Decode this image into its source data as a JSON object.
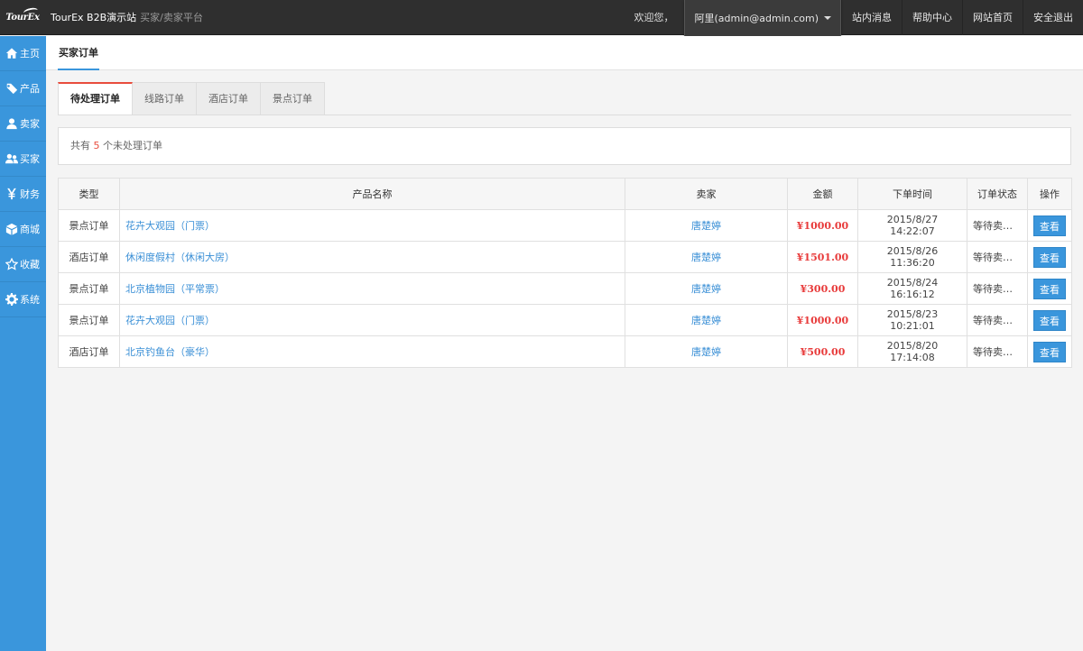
{
  "topbar": {
    "logo_text": "TourEx",
    "site_title": "TourEx B2B演示站",
    "site_subtitle": "买家/卖家平台",
    "welcome": "欢迎您，",
    "user": "阿里(admin@admin.com)",
    "links": [
      "站内消息",
      "帮助中心",
      "网站首页",
      "安全退出"
    ]
  },
  "sidebar": {
    "items": [
      {
        "label": "主页",
        "icon": "home-icon"
      },
      {
        "label": "产品",
        "icon": "tag-icon"
      },
      {
        "label": "卖家",
        "icon": "user-icon"
      },
      {
        "label": "买家",
        "icon": "users-icon"
      },
      {
        "label": "财务",
        "icon": "yen-icon"
      },
      {
        "label": "商城",
        "icon": "box-icon"
      },
      {
        "label": "收藏",
        "icon": "star-icon"
      },
      {
        "label": "系统",
        "icon": "gear-icon"
      }
    ]
  },
  "page": {
    "title": "买家订单",
    "tabs": [
      "待处理订单",
      "线路订单",
      "酒店订单",
      "景点订单"
    ],
    "summary_prefix": "共有",
    "summary_count": "5",
    "summary_suffix": "个未处理订单"
  },
  "table": {
    "headers": [
      "类型",
      "产品名称",
      "卖家",
      "金额",
      "下单时间",
      "订单状态",
      "操作"
    ],
    "rows": [
      {
        "type": "景点订单",
        "product": "花卉大观园（门票）",
        "seller": "唐楚婷",
        "amount": "¥1000.00",
        "time": "2015/8/27 14:22:07",
        "status": "等待卖家...",
        "action": "查看"
      },
      {
        "type": "酒店订单",
        "product": "休闲度假村（休闲大房）",
        "seller": "唐楚婷",
        "amount": "¥1501.00",
        "time": "2015/8/26 11:36:20",
        "status": "等待卖家...",
        "action": "查看"
      },
      {
        "type": "景点订单",
        "product": "北京植物园（平常票）",
        "seller": "唐楚婷",
        "amount": "¥300.00",
        "time": "2015/8/24 16:16:12",
        "status": "等待卖家...",
        "action": "查看"
      },
      {
        "type": "景点订单",
        "product": "花卉大观园（门票）",
        "seller": "唐楚婷",
        "amount": "¥1000.00",
        "time": "2015/8/23 10:21:01",
        "status": "等待卖家...",
        "action": "查看"
      },
      {
        "type": "酒店订单",
        "product": "北京钓鱼台（豪华）",
        "seller": "唐楚婷",
        "amount": "¥500.00",
        "time": "2015/8/20 17:14:08",
        "status": "等待卖家...",
        "action": "查看"
      }
    ]
  },
  "colors": {
    "sidebar": "#3a96dc",
    "topbar": "#2f2f2f",
    "accent_red": "#e84c3d",
    "link_blue": "#3a8fd6"
  }
}
